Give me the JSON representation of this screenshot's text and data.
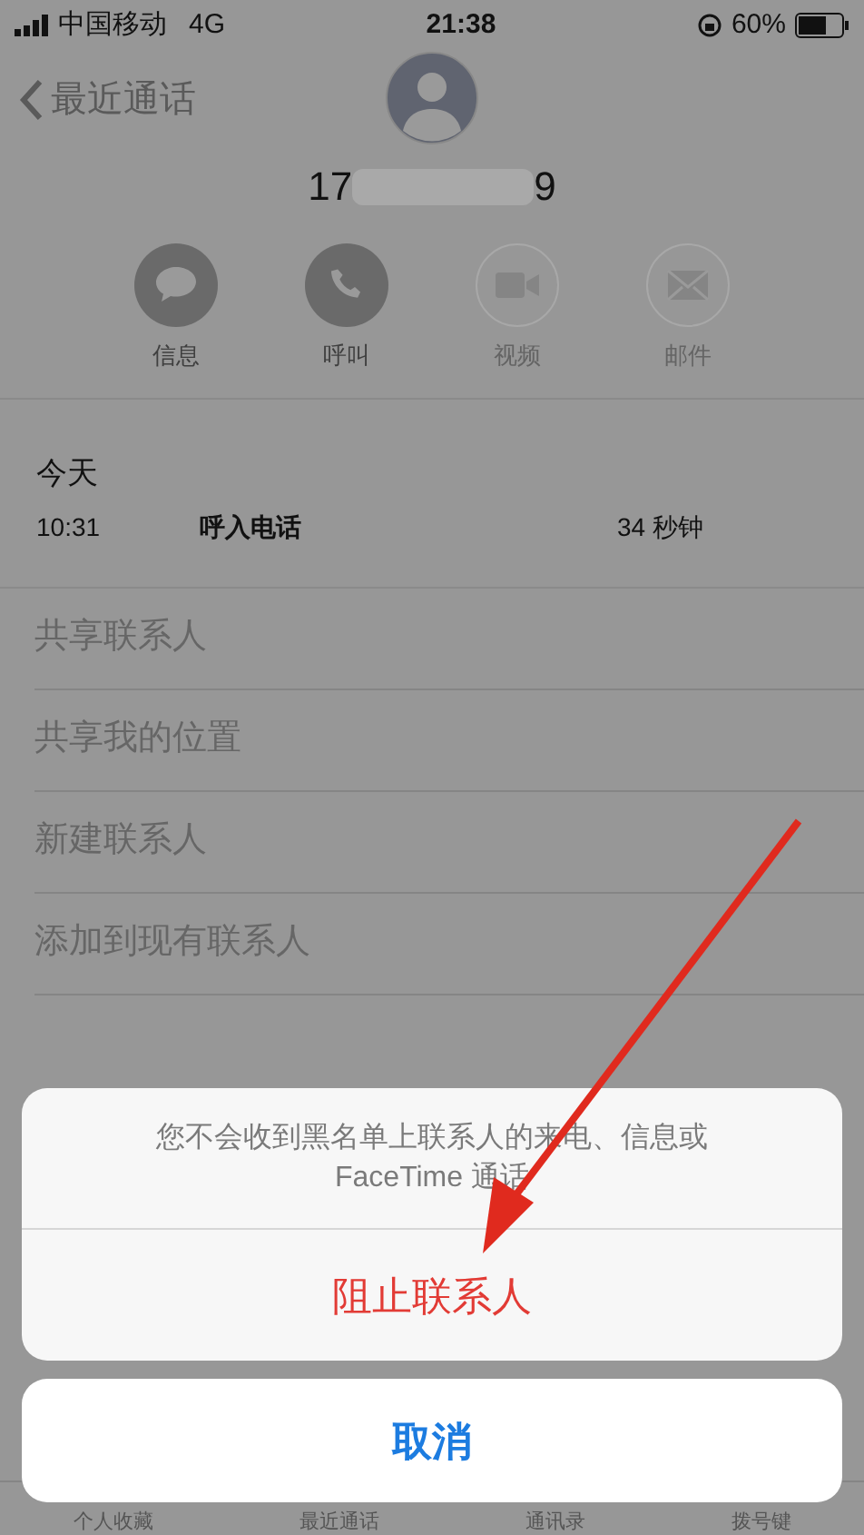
{
  "status_bar": {
    "carrier": "中国移动",
    "network": "4G",
    "time": "21:38",
    "battery": "60%"
  },
  "nav": {
    "back": "最近通话"
  },
  "contact": {
    "number_start": "17",
    "number_end": "9"
  },
  "actions": [
    {
      "kind": "message",
      "label": "信息",
      "disabled": false
    },
    {
      "kind": "call",
      "label": "呼叫",
      "disabled": false
    },
    {
      "kind": "video",
      "label": "视频",
      "disabled": true
    },
    {
      "kind": "mail",
      "label": "邮件",
      "disabled": true
    }
  ],
  "recent": {
    "date": "今天",
    "time": "10:31",
    "type": "呼入电话",
    "duration": "34 秒钟"
  },
  "options": [
    "共享联系人",
    "共享我的位置",
    "新建联系人",
    "添加到现有联系人"
  ],
  "tab_bar": [
    "个人收藏",
    "最近通话",
    "通讯录",
    "拨号键"
  ],
  "action_sheet": {
    "message": "您不会收到黑名单上联系人的来电、信息或 FaceTime 通话",
    "destructive": "阻止联系人",
    "cancel": "取消"
  }
}
